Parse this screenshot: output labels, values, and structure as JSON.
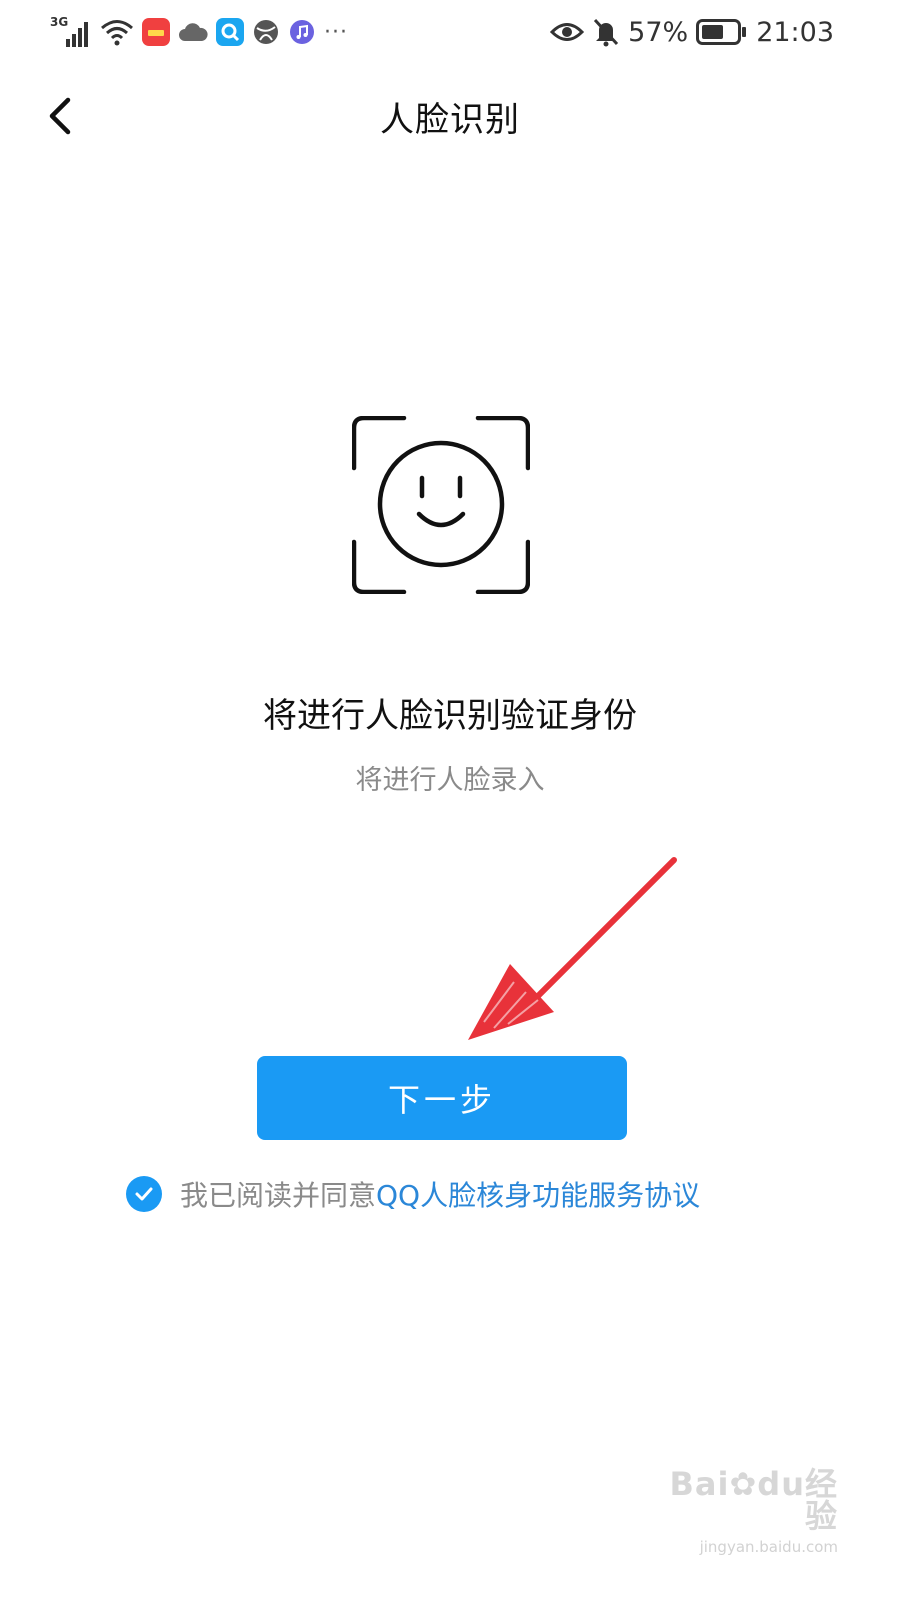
{
  "status_bar": {
    "network_type": "3G",
    "battery_percent": "57%",
    "time": "21:03",
    "overflow": "···",
    "icons": [
      "signal-icon",
      "wifi-icon",
      "notification-app-icon",
      "cloud-icon",
      "search-app-icon",
      "globe-icon",
      "music-icon",
      "eye-icon",
      "bell-muted-icon",
      "battery-icon"
    ]
  },
  "nav": {
    "title": "人脸识别",
    "back_icon": "chevron-left-icon"
  },
  "content": {
    "illustration_icon": "face-scan-icon",
    "heading": "将进行人脸识别验证身份",
    "subheading": "将进行人脸录入",
    "next_button_label": "下一步",
    "agreement_prefix": "我已阅读并同意",
    "agreement_link": "QQ人脸核身功能服务协议",
    "agreement_checked": true
  },
  "annotation": {
    "arrow_icon": "red-arrow-icon",
    "arrow_color": "#e8323a"
  },
  "watermark": {
    "logo": "Bai✿du经验",
    "url": "jingyan.baidu.com"
  },
  "colors": {
    "primary": "#1a9af4",
    "link": "#2b87d8",
    "muted_text": "#8a8a8a"
  }
}
